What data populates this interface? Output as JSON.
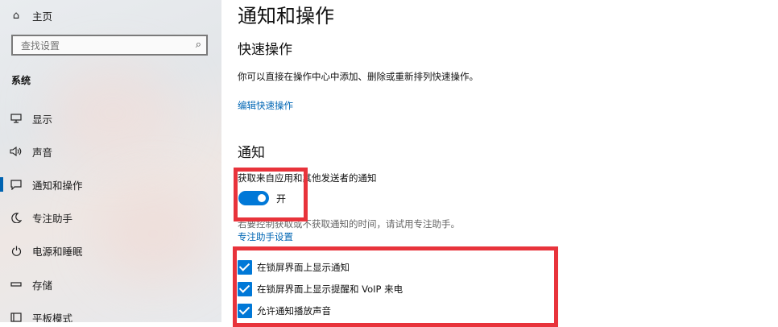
{
  "sidebar": {
    "home_label": "主页",
    "search_placeholder": "查找设置",
    "section_title": "系统",
    "items": [
      {
        "label": "显示",
        "icon": "monitor-icon"
      },
      {
        "label": "声音",
        "icon": "speaker-icon"
      },
      {
        "label": "通知和操作",
        "icon": "notification-icon",
        "active": true
      },
      {
        "label": "专注助手",
        "icon": "moon-icon"
      },
      {
        "label": "电源和睡眠",
        "icon": "power-icon"
      },
      {
        "label": "存储",
        "icon": "storage-icon"
      },
      {
        "label": "平板模式",
        "icon": "tablet-icon"
      }
    ]
  },
  "main": {
    "title": "通知和操作",
    "quick_actions": {
      "heading": "快速操作",
      "description": "你可以直接在操作中心中添加、删除或重新排列快速操作。",
      "edit_link": "编辑快速操作"
    },
    "notifications": {
      "heading": "通知",
      "get_notifications_label": "获取来自应用和其他发送者的通知",
      "toggle_state": "开",
      "focus_hint": "若要控制获取或不获取通知的时间，请试用专注助手。",
      "focus_link": "专注助手设置",
      "options": [
        {
          "label": "在锁屏界面上显示通知",
          "checked": true
        },
        {
          "label": "在锁屏界面上显示提醒和 VoIP 来电",
          "checked": true
        },
        {
          "label": "允许通知播放声音",
          "checked": true
        }
      ]
    }
  },
  "colors": {
    "accent": "#0078d7",
    "link": "#0066b4",
    "highlight": "#e8333b"
  }
}
